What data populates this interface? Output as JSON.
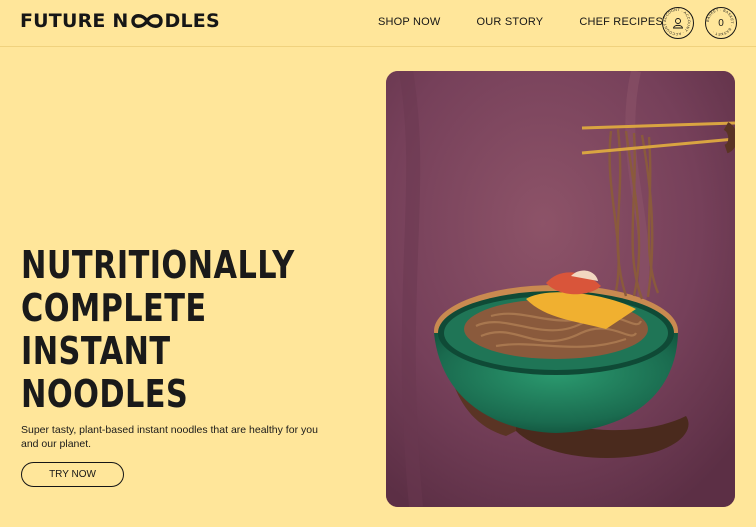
{
  "header": {
    "logo": {
      "part1": "FUTURE N",
      "part2": "DLES"
    },
    "nav": [
      "SHOP NOW",
      "OUR STORY",
      "CHEF RECIPES"
    ],
    "account": {
      "ring_text": "ACCOUNT · ACCOUNT · ACCOUNT ·",
      "icon": "user-icon"
    },
    "basket": {
      "ring_text": "BASKET · BASKET · BASKET ·",
      "count": "0"
    }
  },
  "hero": {
    "headline": [
      "NUTRITIONALLY",
      "COMPLETE",
      "INSTANT",
      "NOODLES"
    ],
    "subtext": "Super tasty, plant-based instant noodles that are healthy for you and our planet.",
    "cta": "TRY NOW",
    "image": "noodle-bowl-photo"
  },
  "colors": {
    "background": "#ffe69a",
    "text": "#1a1a1a",
    "photo_bg": "#7b4458",
    "bowl": "#1e7a5a"
  }
}
